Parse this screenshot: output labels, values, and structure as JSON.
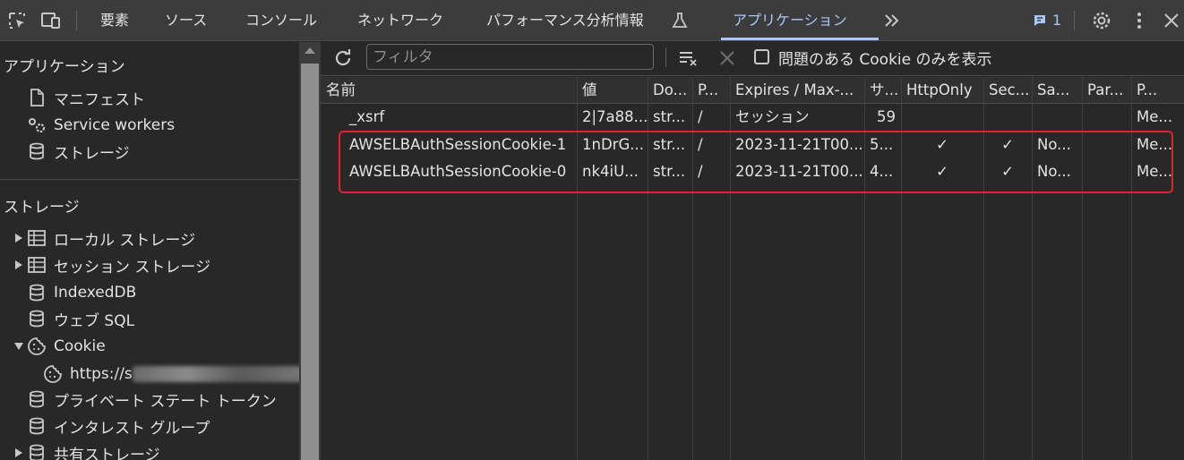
{
  "tabs": {
    "elements": "要素",
    "sources": "ソース",
    "console": "コンソール",
    "network": "ネットワーク",
    "performance": "パフォーマンス分析情報",
    "application": "アプリケーション",
    "issues_count": "1"
  },
  "sidebar": {
    "app_heading": "アプリケーション",
    "app_items": [
      "マニフェスト",
      "Service workers",
      "ストレージ"
    ],
    "storage_heading": "ストレージ",
    "storage_items": [
      "ローカル ストレージ",
      "セッション ストレージ",
      "IndexedDB",
      "ウェブ SQL",
      "Cookie",
      "https://s",
      "プライベート ステート トークン",
      "インタレスト グループ",
      "共有ストレージ"
    ]
  },
  "toolbar": {
    "filter_placeholder": "フィルタ",
    "only_issues_label": "問題のある Cookie のみを表示"
  },
  "table": {
    "headers": [
      "名前",
      "値",
      "Do...",
      "P...",
      "Expires / Max-...",
      "サ...",
      "HttpOnly",
      "Sec...",
      "Sa...",
      "Par...",
      "P..."
    ],
    "rows": [
      [
        "_xsrf",
        "2|7a88...",
        "str...",
        "/",
        "セッション",
        "59",
        "",
        "",
        "",
        "",
        "Me..."
      ],
      [
        "AWSELBAuthSessionCookie-1",
        "1nDrG...",
        "str...",
        "/",
        "2023-11-21T00...",
        "5...",
        "✓",
        "✓",
        "No...",
        "",
        "Me..."
      ],
      [
        "AWSELBAuthSessionCookie-0",
        "nk4iU...",
        "str...",
        "/",
        "2023-11-21T00...",
        "4...",
        "✓",
        "✓",
        "No...",
        "",
        "Me..."
      ]
    ]
  },
  "colors": {
    "accent": "#a8c7fa",
    "highlight": "#e0212f"
  }
}
